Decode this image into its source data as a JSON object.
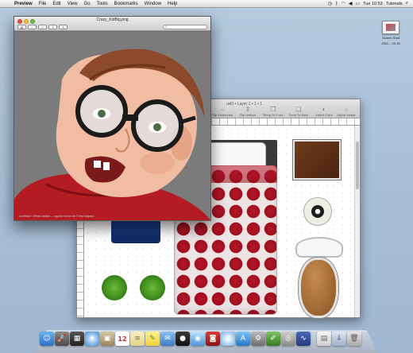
{
  "menubar": {
    "apple": "",
    "items": [
      "Preview",
      "File",
      "Edit",
      "View",
      "Go",
      "Tools",
      "Bookmarks",
      "Window",
      "Help"
    ],
    "clock": "Tue 10:53",
    "user": "Tutorials"
  },
  "desktop": {
    "file_label_1": "Screen Shot",
    "file_label_2": "2011-...03.15"
  },
  "front_window": {
    "title": "Crazy_KidBig.png",
    "caption": "Unofficial / Official created — cgpack Vector Art © http://cgpack"
  },
  "back_window": {
    "title_suffix": "uxl0 • Layer 1 • 1 • 1",
    "toolbar": [
      {
        "label": "Flip Horizontal",
        "icon": "flip-horizontal-icon"
      },
      {
        "label": "Flip Vertical",
        "icon": "flip-vertical-icon"
      },
      {
        "label": "Bring To Front",
        "icon": "bring-to-front-icon"
      },
      {
        "label": "Send To Back",
        "icon": "send-to-back-icon"
      },
      {
        "label": "Adjust Color",
        "icon": "adjust-color-icon"
      },
      {
        "label": "Adjust Image",
        "icon": "adjust-image-icon"
      }
    ]
  },
  "dock": {
    "calendar_day": "12",
    "apps": [
      "finder",
      "launchpad",
      "mission-control",
      "safari",
      "preview",
      "calendar",
      "notes",
      "stickies",
      "mail",
      "facetime",
      "messages",
      "photo-booth",
      "itunes",
      "app-store",
      "preferences",
      "xcode",
      "disk",
      "system-monitor",
      "documents",
      "downloads",
      "trash"
    ]
  }
}
